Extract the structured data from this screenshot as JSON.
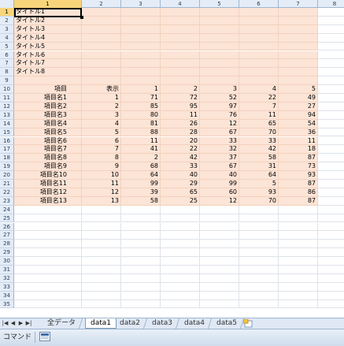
{
  "columns": [
    "1",
    "2",
    "3",
    "4",
    "5",
    "6",
    "7",
    "8"
  ],
  "selected_column": "1",
  "selected_row": "1",
  "row_numbers": [
    "1",
    "2",
    "3",
    "4",
    "5",
    "6",
    "7",
    "8",
    "9",
    "10",
    "11",
    "12",
    "13",
    "14",
    "15",
    "16",
    "17",
    "18",
    "19",
    "20",
    "21",
    "22",
    "23",
    "24",
    "25",
    "26",
    "27",
    "28",
    "29",
    "30",
    "31",
    "32",
    "33",
    "34",
    "35"
  ],
  "titles": [
    "タイトル1",
    "タイトル2",
    "タイトル3",
    "タイトル4",
    "タイトル5",
    "タイトル6",
    "タイトル7",
    "タイトル8"
  ],
  "table": {
    "header": [
      "項目",
      "表示",
      "1",
      "2",
      "3",
      "4",
      "5"
    ],
    "rows": [
      [
        "項目名1",
        "1",
        "71",
        "72",
        "52",
        "22",
        "49"
      ],
      [
        "項目名2",
        "2",
        "85",
        "95",
        "97",
        "7",
        "27"
      ],
      [
        "項目名3",
        "3",
        "80",
        "11",
        "76",
        "11",
        "94"
      ],
      [
        "項目名4",
        "4",
        "81",
        "26",
        "12",
        "65",
        "54"
      ],
      [
        "項目名5",
        "5",
        "88",
        "28",
        "67",
        "70",
        "36"
      ],
      [
        "項目名6",
        "6",
        "11",
        "20",
        "33",
        "33",
        "11"
      ],
      [
        "項目名7",
        "7",
        "41",
        "22",
        "32",
        "42",
        "18"
      ],
      [
        "項目名8",
        "8",
        "2",
        "42",
        "37",
        "58",
        "87"
      ],
      [
        "項目名9",
        "9",
        "68",
        "33",
        "67",
        "31",
        "73"
      ],
      [
        "項目名10",
        "10",
        "64",
        "40",
        "40",
        "64",
        "93"
      ],
      [
        "項目名11",
        "11",
        "99",
        "29",
        "99",
        "5",
        "87"
      ],
      [
        "項目名12",
        "12",
        "39",
        "65",
        "60",
        "93",
        "86"
      ],
      [
        "項目名13",
        "13",
        "58",
        "25",
        "12",
        "70",
        "87"
      ]
    ]
  },
  "tab_nav": [
    "|◀",
    "◀",
    "▶",
    "▶|"
  ],
  "sheet_tabs": [
    "全データ",
    "data1",
    "data2",
    "data3",
    "data4",
    "data5"
  ],
  "active_tab": "data1",
  "status": {
    "mode": "コマンド"
  },
  "colors": {
    "fill": "#fce4d6",
    "header": "#e4ecf7",
    "selected_header": "#f8d57a"
  }
}
